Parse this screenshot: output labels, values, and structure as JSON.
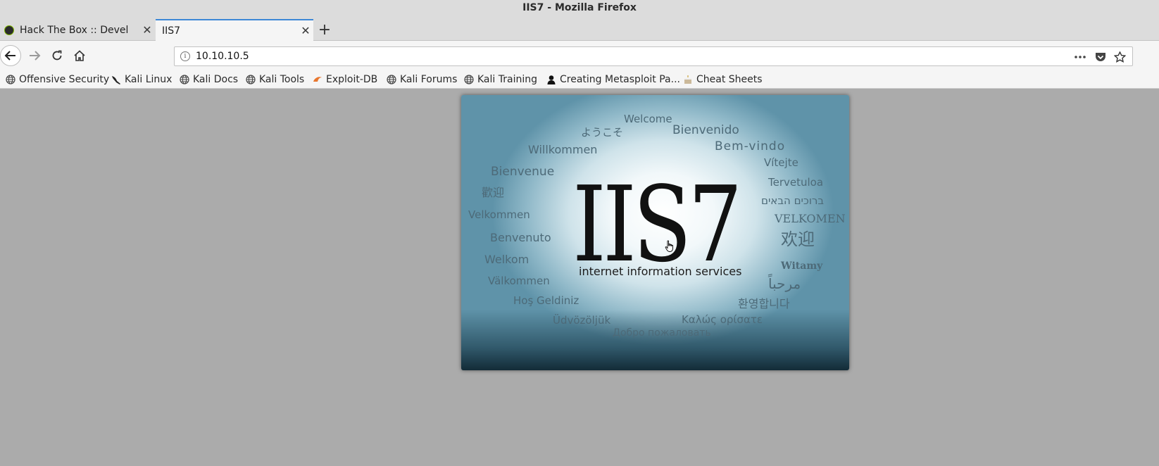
{
  "window": {
    "title": "IIS7 - Mozilla Firefox"
  },
  "tabs": [
    {
      "label": "Hack The Box :: Devel",
      "active": false,
      "icon": "htb-cube-icon"
    },
    {
      "label": "IIS7",
      "active": true
    }
  ],
  "navbar": {
    "url": "10.10.10.5",
    "icons": [
      "back-arrow-icon",
      "forward-arrow-icon",
      "reload-icon",
      "home-icon",
      "info-icon",
      "more-dots-icon",
      "pocket-icon",
      "star-icon"
    ]
  },
  "bookmarks": [
    {
      "label": "Offensive Security",
      "icon": "globe-icon"
    },
    {
      "label": "Kali Linux",
      "icon": "kali-dragon-icon"
    },
    {
      "label": "Kali Docs",
      "icon": "globe-icon"
    },
    {
      "label": "Kali Tools",
      "icon": "globe-icon"
    },
    {
      "label": "Exploit-DB",
      "icon": "exploit-db-icon"
    },
    {
      "label": "Kali Forums",
      "icon": "globe-icon"
    },
    {
      "label": "Kali Training",
      "icon": "globe-icon"
    },
    {
      "label": "Creating Metasploit Pa...",
      "icon": "person-silhouette-icon"
    },
    {
      "label": "Cheat Sheets",
      "icon": "cake-icon"
    }
  ],
  "iis": {
    "logo": "IIS7",
    "subtitle": "internet information services",
    "welcome_words": [
      "Welcome",
      "ようこそ",
      "Bienvenido",
      "Willkommen",
      "Bem-vindo",
      "Vítejte",
      "Bienvenue",
      "Tervetuloa",
      "歡迎",
      "ברוכים הבאים",
      "Velkommen",
      "VELKOMEN",
      "Benvenuto",
      "欢迎",
      "Welkom",
      "Witamy",
      "Välkommen",
      "مرحباً",
      "Hoş Geldiniz",
      "환영합니다",
      "Üdvözöljük",
      "Καλώς ορίσατε",
      "Добро пожаловать"
    ]
  },
  "colors": {
    "accent_tab": "#3d88d6",
    "page_background": "#ababab",
    "chrome_background": "#f5f5f5"
  }
}
